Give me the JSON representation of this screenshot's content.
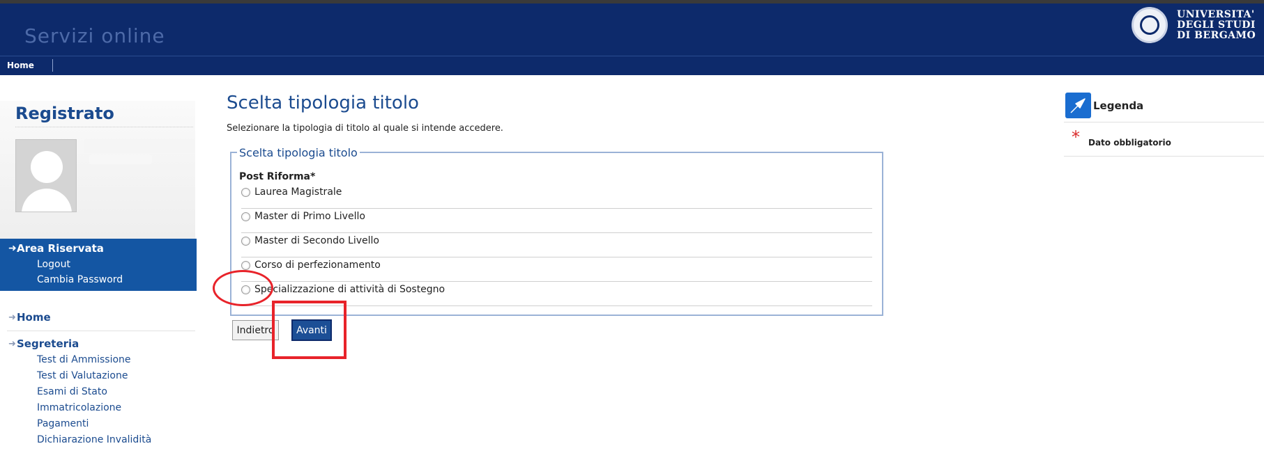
{
  "header": {
    "site_title": "Servizi online",
    "logo_lines": [
      "UNIVERSITA'",
      "DEGLI STUDI",
      "DI BERGAMO"
    ],
    "nav": {
      "home": "Home"
    }
  },
  "sidebar": {
    "title": "Registrato",
    "area_riservata": {
      "title": "Area Riservata",
      "links": [
        "Logout",
        "Cambia Password"
      ]
    },
    "menu": [
      {
        "label": "Home",
        "links": []
      },
      {
        "label": "Segreteria",
        "links": [
          "Test di Ammissione",
          "Test di Valutazione",
          "Esami di Stato",
          "Immatricolazione",
          "Pagamenti",
          "Dichiarazione Invalidità"
        ]
      }
    ]
  },
  "main": {
    "title": "Scelta tipologia titolo",
    "intro": "Selezionare la tipologia di titolo al quale si intende accedere.",
    "fieldset_legend": "Scelta tipologia titolo",
    "group_label": "Post Riforma*",
    "options": [
      "Laurea Magistrale",
      "Master di Primo Livello",
      "Master di Secondo Livello",
      "Corso di perfezionamento",
      "Specializzazione di attività di Sostegno"
    ],
    "buttons": {
      "back": "Indietro",
      "next": "Avanti"
    }
  },
  "legend_panel": {
    "title": "Legenda",
    "items": [
      {
        "symbol": "*",
        "label": "Dato obbligatorio"
      }
    ]
  },
  "colors": {
    "header_bg": "#0d2a6b",
    "accent": "#1b4b8f",
    "sidebar_highlight": "#1456a3",
    "annotation": "#e8232a"
  }
}
